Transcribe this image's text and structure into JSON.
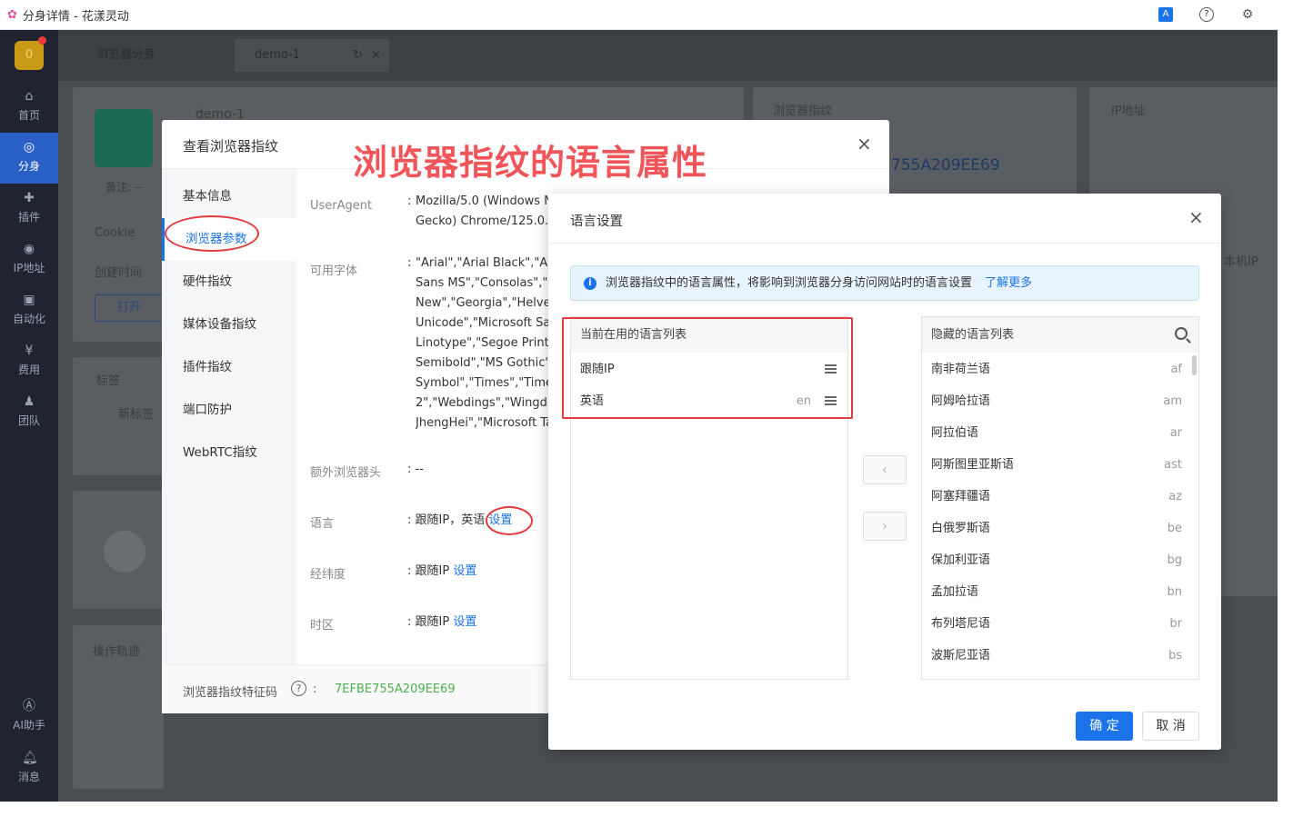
{
  "window": {
    "title": "分身详情 - 花漾灵动"
  },
  "sidebar": {
    "avatar_text": "0",
    "items": [
      {
        "label": "首页",
        "icon": "home-icon"
      },
      {
        "label": "分身",
        "icon": "browser-icon"
      },
      {
        "label": "插件",
        "icon": "puzzle-icon"
      },
      {
        "label": "IP地址",
        "icon": "ip-icon"
      },
      {
        "label": "自动化",
        "icon": "robot-icon"
      },
      {
        "label": "费用",
        "icon": "yen-icon"
      },
      {
        "label": "团队",
        "icon": "team-icon"
      },
      {
        "label": "AI助手",
        "icon": "ai-icon"
      },
      {
        "label": "消息",
        "icon": "bell-icon"
      }
    ]
  },
  "tabs": [
    {
      "label": "浏览器分身"
    },
    {
      "label": "demo-1"
    }
  ],
  "background": {
    "profile_name": "demo-1",
    "remark_label": "备注:",
    "remark_value": "--",
    "cookie_label": "Cookie",
    "created_label": "创建时间",
    "open_button": "打开",
    "fingerprint_panel": "浏览器指纹",
    "ip_panel": "IP地址",
    "fingerprint_code_partial": "755A209EE69",
    "tags_label": "标签",
    "new_tag": "新标签",
    "trail_label": "操作轨迹",
    "local_ip_partial": "本机IP"
  },
  "annotation": "浏览器指纹的语言属性",
  "dialog1": {
    "title": "查看浏览器指纹",
    "nav": [
      "基本信息",
      "浏览器参数",
      "硬件指纹",
      "媒体设备指纹",
      "插件指纹",
      "端口防护",
      "WebRTC指纹"
    ],
    "fields": {
      "useragent_label": "UserAgent",
      "useragent_value1": "Mozilla/5.0 (Windows N",
      "useragent_value2": "Gecko) Chrome/125.0.6",
      "fonts_label": "可用字体",
      "fonts_lines": [
        "\"Arial\",\"Arial Black\",\"Aria",
        "Sans MS\",\"Consolas\",\"C",
        "New\",\"Georgia\",\"Helveti",
        "Unicode\",\"Microsoft San",
        "Linotype\",\"Segoe Print\",",
        "Semibold\",\"MS Gothic\",",
        "Symbol\",\"Times\",\"Times",
        "2\",\"Webdings\",\"Wingdir",
        "JhengHei\",\"Microsoft Ta"
      ],
      "extra_header_label": "额外浏览器头",
      "extra_header_value": "--",
      "language_label": "语言",
      "language_value": "跟随IP，英语",
      "language_link": "设置",
      "geo_label": "经纬度",
      "geo_value": "跟随IP",
      "geo_link": "设置",
      "timezone_label": "时区",
      "timezone_value": "跟随IP",
      "timezone_link": "设置"
    },
    "footer_label": "浏览器指纹特征码",
    "footer_code": "7EFBE755A209EE69"
  },
  "dialog2": {
    "title": "语言设置",
    "info_text": "浏览器指纹中的语言属性，将影响到浏览器分身访问网站时的语言设置",
    "info_link": "了解更多",
    "current_list": {
      "title": "当前在用的语言列表",
      "items": [
        {
          "name": "跟随IP",
          "code": ""
        },
        {
          "name": "英语",
          "code": "en"
        }
      ]
    },
    "hidden_list": {
      "title": "隐藏的语言列表",
      "items": [
        {
          "name": "南非荷兰语",
          "code": "af"
        },
        {
          "name": "阿姆哈拉语",
          "code": "am"
        },
        {
          "name": "阿拉伯语",
          "code": "ar"
        },
        {
          "name": "阿斯图里亚斯语",
          "code": "ast"
        },
        {
          "name": "阿塞拜疆语",
          "code": "az"
        },
        {
          "name": "白俄罗斯语",
          "code": "be"
        },
        {
          "name": "保加利亚语",
          "code": "bg"
        },
        {
          "name": "孟加拉语",
          "code": "bn"
        },
        {
          "name": "布列塔尼语",
          "code": "br"
        },
        {
          "name": "波斯尼亚语",
          "code": "bs"
        }
      ]
    },
    "ok_label": "确 定",
    "cancel_label": "取 消"
  },
  "colors": {
    "accent": "#1a73e8",
    "annotation": "#f0555a",
    "sidebar": "#1f2430"
  }
}
